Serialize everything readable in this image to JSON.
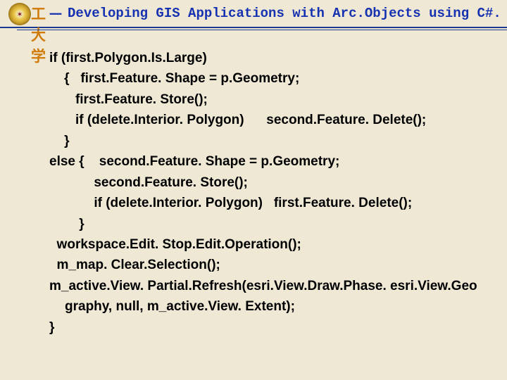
{
  "header": {
    "university": "西理工大学",
    "separator": "－",
    "title": "Developing GIS Applications with Arc.Objects using C#. NE"
  },
  "code": {
    "l1": "if (first.Polygon.Is.Large)",
    "l2": "    {   first.Feature. Shape = p.Geometry;",
    "l3": "       first.Feature. Store();",
    "l4": "       if (delete.Interior. Polygon)      second.Feature. Delete();",
    "l5": "    }",
    "l6": "else {    second.Feature. Shape = p.Geometry;",
    "l7": "            second.Feature. Store();",
    "l8": "            if (delete.Interior. Polygon)   first.Feature. Delete();",
    "l9": "        }",
    "l10": "  workspace.Edit. Stop.Edit.Operation();",
    "l11": "  m_map. Clear.Selection();",
    "l12a": "m_active.View. Partial.Refresh(esri.View.Draw.Phase. esri.View.Geo",
    "l12b": "graphy, null, m_active.View. Extent);",
    "l13": "}"
  }
}
